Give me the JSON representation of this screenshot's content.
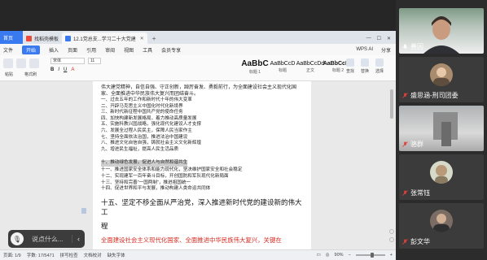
{
  "tabs": [
    {
      "label": "首页",
      "kind": "home"
    },
    {
      "label": "找稻壳模板",
      "kind": "template"
    },
    {
      "label": "12.1党总支...学习二十大党建",
      "kind": "doc"
    }
  ],
  "menu": {
    "items": [
      "文件",
      "开始",
      "插入",
      "页面",
      "引用",
      "审阅",
      "视图",
      "工具",
      "会员专享"
    ],
    "active": "开始",
    "right": [
      "WPS AI",
      "分享"
    ]
  },
  "ribbon": {
    "font_name": "宋体",
    "font_size": "11",
    "format_buttons": [
      "B",
      "I",
      "U",
      "A"
    ],
    "labels": [
      "粘贴",
      "格式刷"
    ],
    "styles": [
      {
        "preview": "AaBbC",
        "caption": "标题 1"
      },
      {
        "preview": "AaBbCcD",
        "caption": "标题"
      },
      {
        "preview": "AaBbCcDd",
        "caption": "正文"
      },
      {
        "preview": "AaBbCcDd",
        "caption": "标题 2"
      }
    ],
    "right_tools": [
      "查找",
      "替换",
      "选择"
    ]
  },
  "document": {
    "intro": "伟大建党精神，自信自强、守正创新，踔厉奋发、勇毅前行，为全面建设社会主义现代化国家、全面推进中华民族伟大复兴而团结奋斗。",
    "list": [
      "一、过去五年的工作和新时代十年的伟大变革",
      "二、开辟马克思主义中国化时代化新境界",
      "三、新时代新征程中国共产党的使命任务",
      "四、加快构建新发展格局，着力推动高质量发展",
      "五、实施科教兴国战略，强化现代化建设人才支撑",
      "六、发展全过程人民民主，保障人民当家作主",
      "七、坚持全面依法治国，推进法治中国建设",
      "八、推进文化自信自强，铸就社会主义文化新辉煌",
      "九、增进民生福祉，提高人民生活品质",
      "十、推动绿色发展，促进人与自然和谐共生",
      "十一、推进国家安全体系和能力现代化，坚决维护国家安全和社会稳定",
      "十二、实现建军一百年奋斗目标，开创国防和军队现代化新局面",
      "十三、坚持和完善“一国两制”，推进祖国统一",
      "十四、促进世界和平与发展，推动构建人类命运共同体"
    ],
    "highlighted_index": 9,
    "heading15_line1": "十五、坚定不移全面从严治党，深入推进新时代党的建设新的伟大工",
    "heading15_line2": "程",
    "red_line": "全面建设社会主义现代化国家、全面推进中华民族伟大复兴，关键在"
  },
  "status": {
    "page": "页面: 1/9",
    "words": "字数: 17/5471",
    "spellcheck": "拼写检查",
    "proofread": "文档校对",
    "missing_font": "缺失字体",
    "zoom": "90%",
    "zoom_fraction": 0.55
  },
  "caption": {
    "placeholder": "说点什么..."
  },
  "participants": [
    {
      "name": "善因",
      "mic_muted": false,
      "kind": "video"
    },
    {
      "name": "盛思涵-刑司团委",
      "mic_muted": true,
      "kind": "avatar"
    },
    {
      "name": "骆群",
      "mic_muted": true,
      "kind": "video2"
    },
    {
      "name": "张常钰",
      "mic_muted": true,
      "kind": "avatar"
    },
    {
      "name": "彭文华",
      "mic_muted": true,
      "kind": "avatar"
    }
  ],
  "colors": {
    "accent": "#3a7af0",
    "red_text": "#d62a20",
    "mic_red": "#e0403a"
  }
}
